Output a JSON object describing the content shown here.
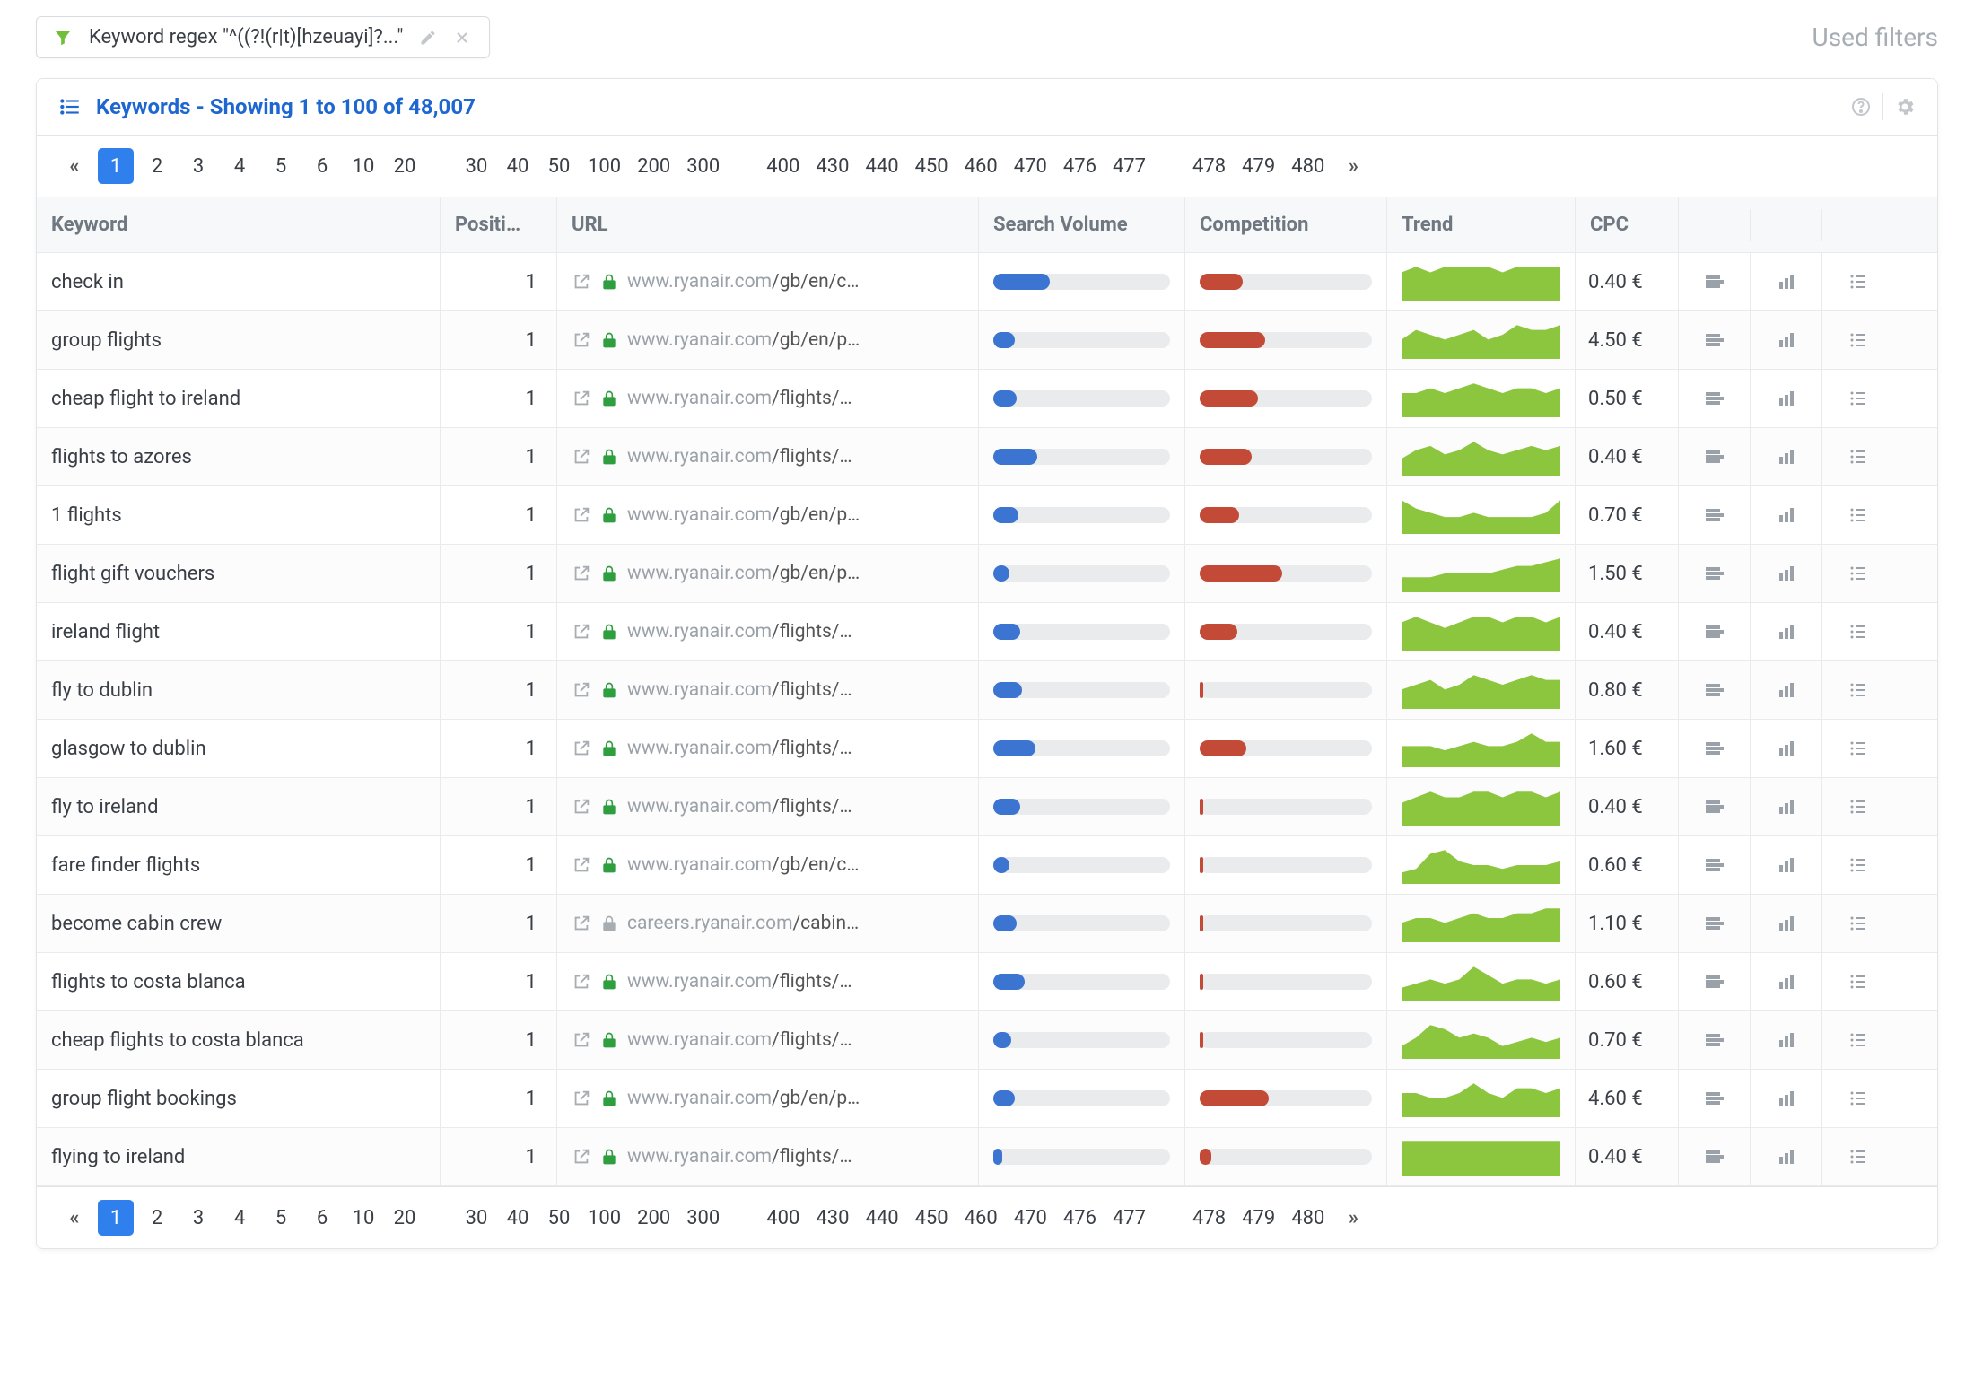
{
  "topbar": {
    "filter_label": "Keyword regex \"^((?!(r|t)[hzeuayi]?...\"",
    "used_filters": "Used filters"
  },
  "panel": {
    "title": "Keywords - Showing 1 to 100 of 48,007"
  },
  "pager": {
    "active": "1",
    "pages": [
      "1",
      "2",
      "3",
      "4",
      "5",
      "6",
      "10",
      "20",
      "",
      "30",
      "40",
      "50",
      "100",
      "200",
      "300",
      "",
      "400",
      "430",
      "440",
      "450",
      "460",
      "470",
      "476",
      "477",
      "",
      "478",
      "479",
      "480"
    ]
  },
  "columns": {
    "keyword": "Keyword",
    "position": "Positi…",
    "url": "URL",
    "search_volume": "Search Volume",
    "competition": "Competition",
    "trend": "Trend",
    "cpc": "CPC"
  },
  "rows": [
    {
      "keyword": "check in",
      "position": "1",
      "url_sub": "www.ryanair.com",
      "url_main": "/gb/en/c…",
      "lock": "green",
      "sv": 32,
      "comp": 25,
      "trend": [
        5,
        6,
        5,
        6,
        6,
        6,
        6,
        5,
        6,
        6,
        6,
        6
      ],
      "cpc": "0.40 €"
    },
    {
      "keyword": "group flights",
      "position": "1",
      "url_sub": "www.ryanair.com",
      "url_main": "/gb/en/p…",
      "lock": "green",
      "sv": 12,
      "comp": 38,
      "trend": [
        4,
        6,
        5,
        4,
        5,
        6,
        4,
        5,
        7,
        6,
        6,
        7
      ],
      "cpc": "4.50 €"
    },
    {
      "keyword": "cheap flight to ireland",
      "position": "1",
      "url_sub": "www.ryanair.com",
      "url_main": "/flights/…",
      "lock": "green",
      "sv": 13,
      "comp": 34,
      "trend": [
        5,
        5,
        6,
        5,
        6,
        7,
        6,
        5,
        6,
        6,
        5,
        6
      ],
      "cpc": "0.50 €"
    },
    {
      "keyword": "flights to azores",
      "position": "1",
      "url_sub": "www.ryanair.com",
      "url_main": "/flights/…",
      "lock": "green",
      "sv": 25,
      "comp": 30,
      "trend": [
        4,
        6,
        7,
        5,
        6,
        8,
        6,
        5,
        6,
        7,
        6,
        7
      ],
      "cpc": "0.40 €"
    },
    {
      "keyword": "1 flights",
      "position": "1",
      "url_sub": "www.ryanair.com",
      "url_main": "/gb/en/p…",
      "lock": "green",
      "sv": 14,
      "comp": 23,
      "trend": [
        8,
        6,
        5,
        4,
        4,
        5,
        4,
        4,
        4,
        4,
        5,
        8
      ],
      "cpc": "0.70 €"
    },
    {
      "keyword": "flight gift vouchers",
      "position": "1",
      "url_sub": "www.ryanair.com",
      "url_main": "/gb/en/p…",
      "lock": "green",
      "sv": 9,
      "comp": 48,
      "trend": [
        4,
        4,
        4,
        5,
        5,
        5,
        5,
        6,
        7,
        7,
        8,
        9
      ],
      "cpc": "1.50 €"
    },
    {
      "keyword": "ireland flight",
      "position": "1",
      "url_sub": "www.ryanair.com",
      "url_main": "/flights/…",
      "lock": "green",
      "sv": 15,
      "comp": 22,
      "trend": [
        5,
        6,
        5,
        4,
        5,
        6,
        6,
        5,
        6,
        6,
        5,
        6
      ],
      "cpc": "0.40 €"
    },
    {
      "keyword": "fly to dublin",
      "position": "1",
      "url_sub": "www.ryanair.com",
      "url_main": "/flights/…",
      "lock": "green",
      "sv": 16,
      "comp": 2,
      "trend": [
        4,
        5,
        6,
        4,
        5,
        7,
        6,
        5,
        6,
        7,
        6,
        6
      ],
      "cpc": "0.80 €"
    },
    {
      "keyword": "glasgow to dublin",
      "position": "1",
      "url_sub": "www.ryanair.com",
      "url_main": "/flights/…",
      "lock": "green",
      "sv": 24,
      "comp": 27,
      "trend": [
        5,
        5,
        5,
        4,
        5,
        6,
        5,
        5,
        6,
        8,
        6,
        6
      ],
      "cpc": "1.60 €"
    },
    {
      "keyword": "fly to ireland",
      "position": "1",
      "url_sub": "www.ryanair.com",
      "url_main": "/flights/…",
      "lock": "green",
      "sv": 15,
      "comp": 2,
      "trend": [
        4,
        5,
        6,
        5,
        5,
        6,
        6,
        5,
        6,
        6,
        5,
        6
      ],
      "cpc": "0.40 €"
    },
    {
      "keyword": "fare finder flights",
      "position": "1",
      "url_sub": "www.ryanair.com",
      "url_main": "/gb/en/c…",
      "lock": "green",
      "sv": 9,
      "comp": 2,
      "trend": [
        3,
        4,
        8,
        9,
        6,
        5,
        5,
        4,
        5,
        5,
        5,
        6
      ],
      "cpc": "0.60 €"
    },
    {
      "keyword": "become cabin crew",
      "position": "1",
      "url_sub": "careers.ryanair.com",
      "url_main": "/cabin…",
      "lock": "grey",
      "sv": 13,
      "comp": 2,
      "trend": [
        4,
        5,
        5,
        4,
        5,
        6,
        5,
        5,
        6,
        6,
        7,
        7
      ],
      "cpc": "1.10 €"
    },
    {
      "keyword": "flights to costa blanca",
      "position": "1",
      "url_sub": "www.ryanair.com",
      "url_main": "/flights/…",
      "lock": "green",
      "sv": 18,
      "comp": 2,
      "trend": [
        3,
        4,
        5,
        4,
        5,
        8,
        6,
        4,
        5,
        5,
        4,
        5
      ],
      "cpc": "0.60 €"
    },
    {
      "keyword": "cheap flights to costa blanca",
      "position": "1",
      "url_sub": "www.ryanair.com",
      "url_main": "/flights/…",
      "lock": "green",
      "sv": 10,
      "comp": 2,
      "trend": [
        3,
        5,
        8,
        7,
        5,
        6,
        5,
        3,
        4,
        5,
        4,
        5
      ],
      "cpc": "0.70 €"
    },
    {
      "keyword": "group flight bookings",
      "position": "1",
      "url_sub": "www.ryanair.com",
      "url_main": "/gb/en/p…",
      "lock": "green",
      "sv": 12,
      "comp": 40,
      "trend": [
        5,
        5,
        4,
        4,
        5,
        7,
        5,
        4,
        6,
        6,
        5,
        6
      ],
      "cpc": "4.60 €"
    },
    {
      "keyword": "flying to ireland",
      "position": "1",
      "url_sub": "www.ryanair.com",
      "url_main": "/flights/…",
      "lock": "green",
      "sv": 5,
      "comp": 7,
      "trend": [
        4,
        4,
        4,
        4,
        4,
        4,
        4,
        4,
        4,
        4,
        4,
        4
      ],
      "cpc": "0.40 €"
    }
  ]
}
